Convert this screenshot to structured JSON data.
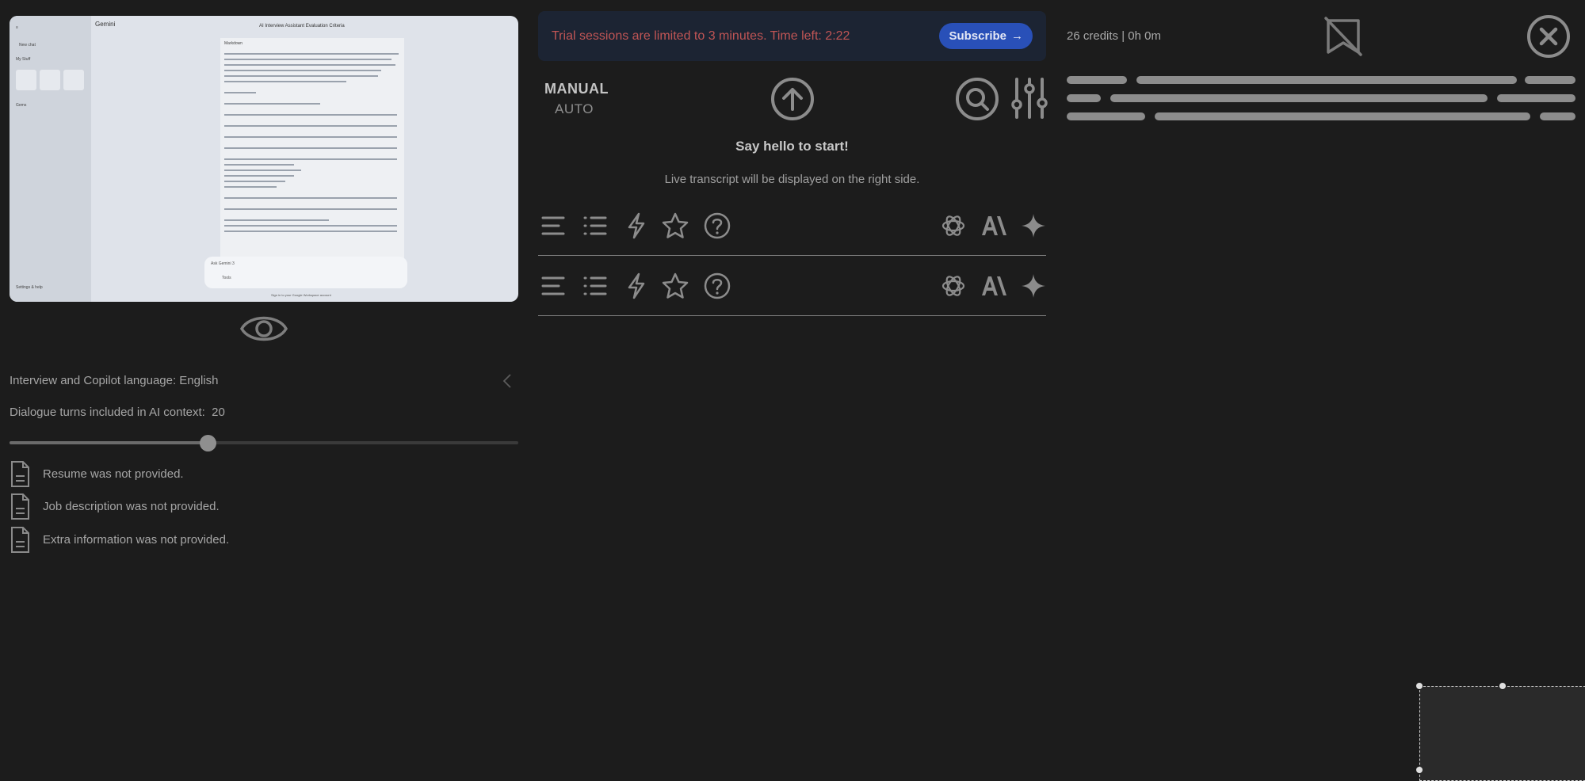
{
  "preview": {
    "app_name": "Gemini",
    "doc_title": "AI Interview Assistant Evaluation Criteria",
    "sidebar_new_chat": "New chat",
    "sidebar_my_stuff": "My Stuff",
    "sidebar_gems": "Gems",
    "sidebar_settings": "Settings & help",
    "doc_header": "Markdown",
    "chat_placeholder": "Ask Gemini 3",
    "chat_tools": "Tools",
    "footer": "Sign in to your Google Workspace account"
  },
  "settings": {
    "language_label": "Interview and Copilot language: English",
    "turns_label": "Dialogue turns included in AI context:",
    "turns_value": "20",
    "turns_fraction": 0.39
  },
  "files": [
    {
      "text": "Resume was not provided.",
      "icon": "document-icon"
    },
    {
      "text": "Job description was not provided.",
      "icon": "document-icon"
    },
    {
      "text": "Extra information was not provided.",
      "icon": "document-icon"
    }
  ],
  "banner": {
    "message": "Trial sessions are limited to 3 minutes. Time left: 2:22",
    "subscribe_label": "Subscribe",
    "subscribe_arrow": "→"
  },
  "mode": {
    "manual": "MANUAL",
    "auto": "AUTO"
  },
  "center": {
    "hello": "Say hello to start!",
    "hint": "Live transcript will be displayed on the right side."
  },
  "toolbar_icons": [
    "lines-icon",
    "list-icon",
    "lightning-icon",
    "star-icon",
    "help-icon",
    "openai-icon",
    "anthropic-icon",
    "gemini-sparkle-icon"
  ],
  "credits": "26 credits | 0h 0m",
  "colors": {
    "background": "#1c1c1c",
    "banner_bg": "#1c2433",
    "banner_text": "#c05555",
    "subscribe_bg": "#2950b8"
  }
}
